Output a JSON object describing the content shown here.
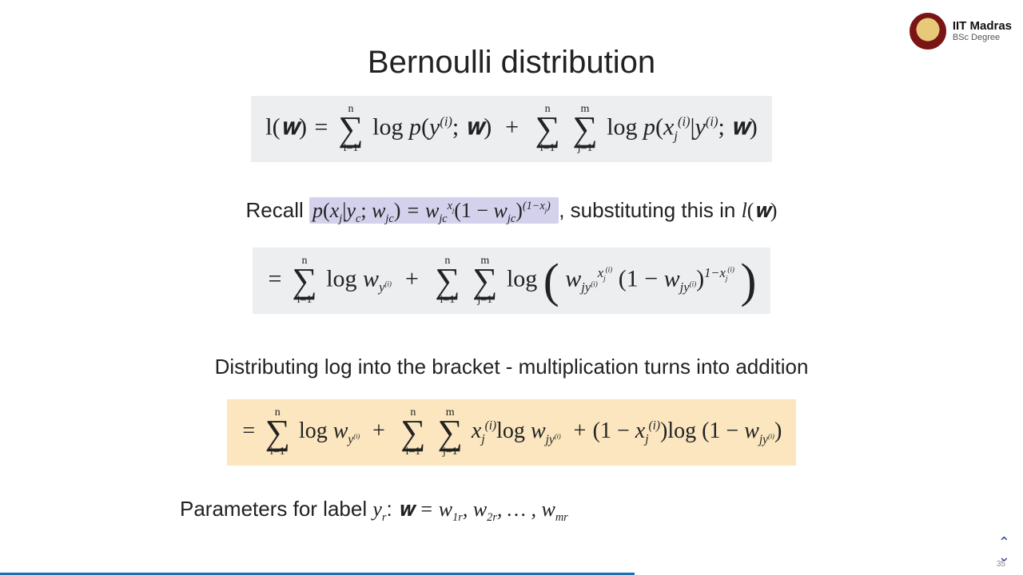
{
  "logo": {
    "line1": "IIT Madras",
    "line2": "BSc Degree"
  },
  "title": "Bernoulli distribution",
  "eq1": "l(𝐰) = Σ_{i=1}^{n} log p(y^{(i)}; 𝐰) + Σ_{i=1}^{n} Σ_{j=1}^{m} log p(x_j^{(i)} | y^{(i)}; 𝐰)",
  "recall_prefix": "Recall ",
  "recall_formula": "p(x_j | y_c ; w_{jc}) = w_{jc}^{x_j} (1 − w_{jc})^{(1−x_j)}",
  "recall_suffix": " , substituting this in ",
  "recall_tail": "l(𝐰)",
  "eq2": "= Σ_{i=1}^{n} log w_{y^{(i)}} + Σ_{i=1}^{n} Σ_{j=1}^{m} log ( w_{jy^{(i)}}^{x_j^{(i)}} (1 − w_{jy^{(i)}})^{1−x_j^{(i)}} )",
  "dist_text": "Distributing log into the bracket - multiplication turns into addition",
  "eq3": "= Σ_{i=1}^{n} log w_{y^{(i)}} + Σ_{i=1}^{n} Σ_{j=1}^{m} x_j^{(i)} log w_{jy^{(i)}} + (1 − x_j^{(i)}) log (1 − w_{jy^{(i)}})",
  "params_prefix": "Parameters for label ",
  "params_label": "y_r",
  "params_colon": ": ",
  "params_formula": "𝐰 = w_{1r}, w_{2r}, … , w_{mr}",
  "page": "35",
  "progress_pct": 62
}
